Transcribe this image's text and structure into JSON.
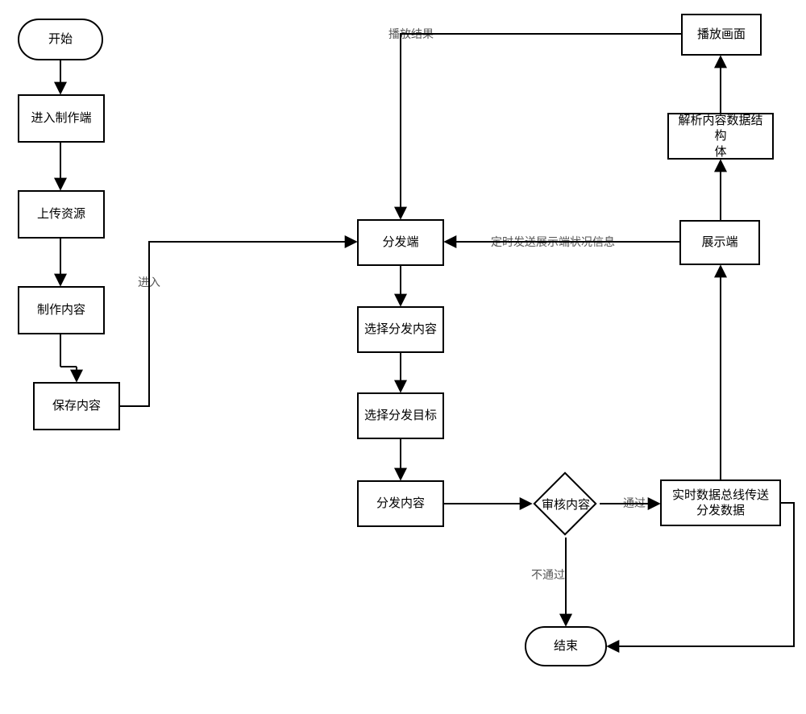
{
  "nodes": {
    "start": "开始",
    "enter_production": "进入制作端",
    "upload_resource": "上传资源",
    "create_content": "制作内容",
    "save_content": "保存内容",
    "distribution_end": "分发端",
    "select_distribute_content": "选择分发内容",
    "select_distribute_target": "选择分发目标",
    "distribute_content": "分发内容",
    "review_content": "审核内容",
    "bus_send": "实时数据总线传送\n分发数据",
    "display_end": "展示端",
    "parse_content": "解析内容数据结构\n体",
    "play_screen": "播放画面",
    "end": "结束"
  },
  "edge_labels": {
    "enter": "进入",
    "play_result": "播放结果",
    "timed_status": "定时发送展示端状况信息",
    "pass": "通过",
    "fail": "不通过"
  }
}
